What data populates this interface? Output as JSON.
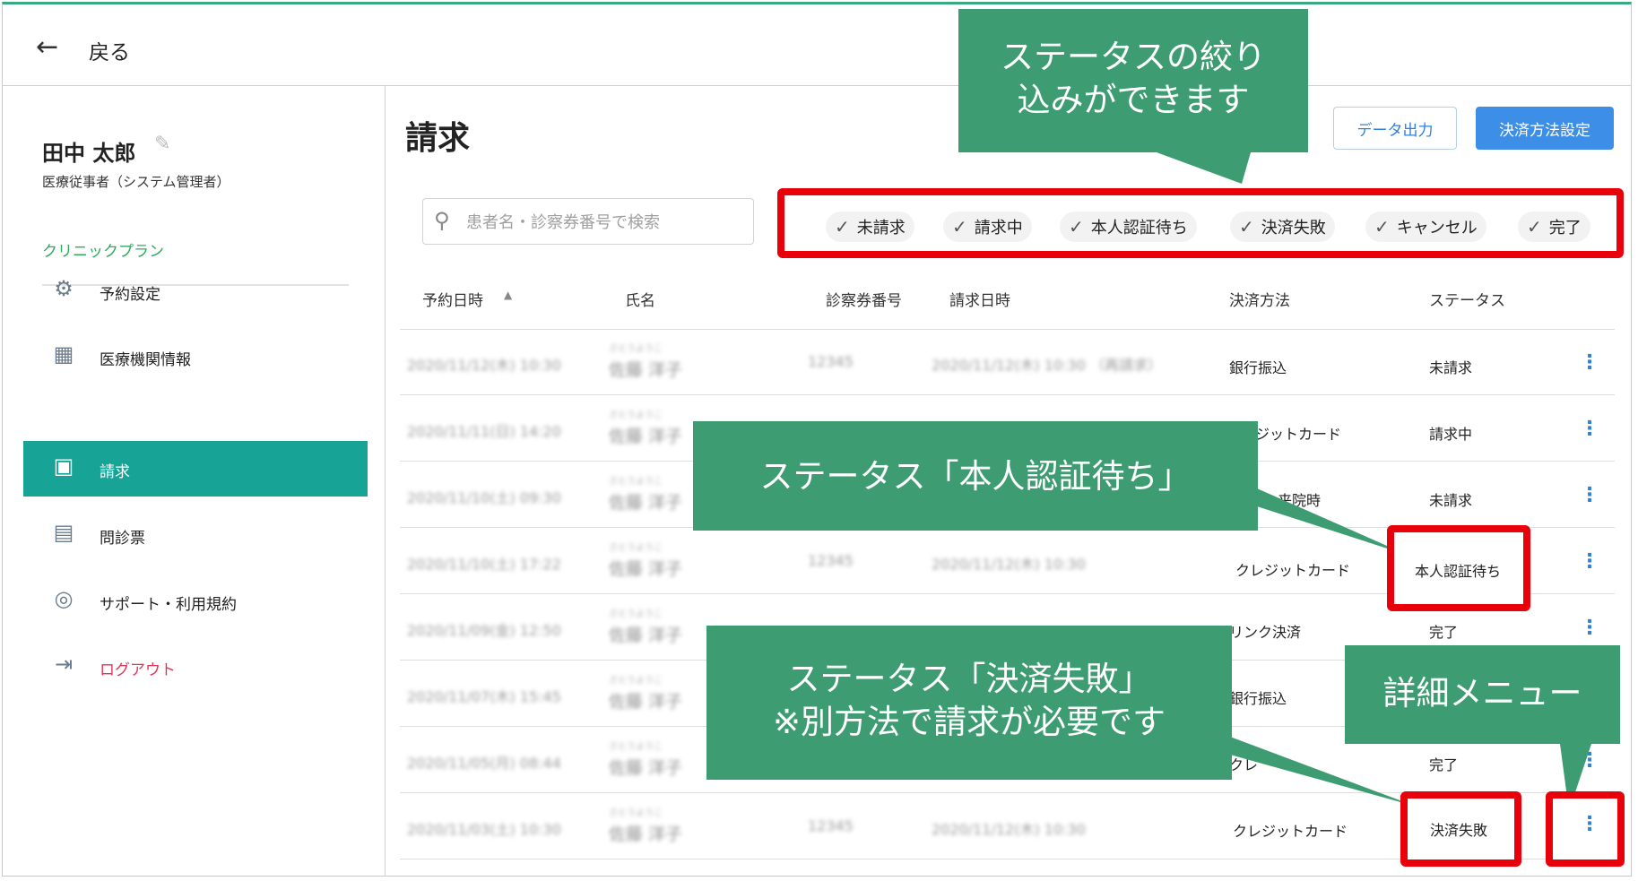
{
  "topbar": {
    "back_label": "戻る"
  },
  "sidebar": {
    "user_name": "田中 太郎",
    "user_role": "医療従事者（システム管理者）",
    "plan": "クリニックプラン",
    "items": [
      {
        "label": "予約設定",
        "icon": "gear-icon"
      },
      {
        "label": "医療機関情報",
        "icon": "building-icon"
      },
      {
        "label": "請求",
        "icon": "billing-icon"
      },
      {
        "label": "問診票",
        "icon": "document-icon"
      },
      {
        "label": "サポート・利用規約",
        "icon": "lifebuoy-icon"
      },
      {
        "label": "ログアウト",
        "icon": "logout-icon"
      }
    ]
  },
  "main": {
    "title": "請求",
    "export_button": "データ出力",
    "payment_settings_button": "決済方法設定",
    "search_placeholder": "患者名・診察券番号で検索",
    "filters": [
      "未請求",
      "請求中",
      "本人認証待ち",
      "決済失敗",
      "キャンセル",
      "完了"
    ],
    "columns": [
      "予約日時",
      "氏名",
      "診察券番号",
      "請求日時",
      "決済方法",
      "ステータス"
    ],
    "rows": [
      {
        "date": "2020/11/12(木) 10:30",
        "kana": "さとうようこ",
        "name": "佐藤 洋子",
        "card": "12345",
        "billed": "2020/11/12(木) 10:30 （再請求）",
        "method": "銀行振込",
        "status": "未請求"
      },
      {
        "date": "2020/11/11(日) 14:20",
        "kana": "さとうようこ",
        "name": "佐藤 洋子",
        "card": "",
        "billed": "",
        "method": "ジットカード",
        "status": "請求中"
      },
      {
        "date": "2020/11/10(土) 09:30",
        "kana": "さとうようこ",
        "name": "佐藤 洋子",
        "card": "",
        "billed": "",
        "method": "来院時",
        "status": "未請求"
      },
      {
        "date": "2020/11/10(土) 17:22",
        "kana": "さとうようこ",
        "name": "佐藤 洋子",
        "card": "12345",
        "billed": "2020/11/12(木) 10:30",
        "method": "クレジットカード",
        "status": "本人認証待ち"
      },
      {
        "date": "2020/11/09(金) 12:50",
        "kana": "さとうようこ",
        "name": "佐藤 洋子",
        "card": "",
        "billed": "",
        "method": "リンク決済",
        "status": "完了"
      },
      {
        "date": "2020/11/07(木) 15:45",
        "kana": "さとうようこ",
        "name": "佐藤 洋子",
        "card": "",
        "billed": "",
        "method": "銀行振込",
        "status": ""
      },
      {
        "date": "2020/11/05(月) 08:44",
        "kana": "さとうようこ",
        "name": "佐藤 洋子",
        "card": "",
        "billed": "",
        "method": "クレ",
        "status": "完了"
      },
      {
        "date": "2020/11/03(土) 10:30",
        "kana": "さとうようこ",
        "name": "佐藤 洋子",
        "card": "12345",
        "billed": "2020/11/12(木) 10:30",
        "method": "クレジットカード",
        "status": "決済失敗"
      }
    ]
  },
  "callouts": {
    "filter": [
      "ステータスの絞り",
      "込みができます"
    ],
    "auth_status": "ステータス「本人認証待ち」",
    "failed_status": [
      "ステータス「決済失敗」",
      "※別方法で請求が必要です"
    ],
    "detail_menu": "詳細メニュー"
  },
  "colors": {
    "accent_teal": "#17a396",
    "callout_green": "#3e9c72",
    "highlight_red": "#e8000b",
    "primary_blue": "#3d8ee6",
    "logout_red": "#e03355",
    "plan_green": "#2eab5c"
  }
}
